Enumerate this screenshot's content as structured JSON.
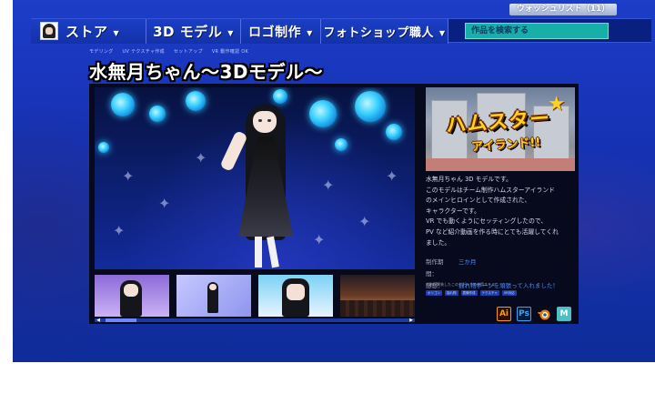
{
  "wishlist": {
    "label": "ウォッシュリスト（11）"
  },
  "nav": {
    "store_label": "ストア",
    "model_label": "3D モデル",
    "logo_label": "ロゴ制作",
    "photoshop_label": "フォトショップ職人",
    "caret": "▼",
    "search_placeholder": "作品を検索する"
  },
  "breadcrumb": [
    "モデリング",
    "UV テクスチャ作成",
    "セットアップ",
    "VR 動作確認 OK"
  ],
  "page": {
    "title": "水無月ちゃん〜3Dモデル〜"
  },
  "gallery": {
    "scroll_left": "◀",
    "scroll_right": "▶"
  },
  "banner": {
    "logo_main": "ハムスター",
    "logo_sub": "アイランド!!",
    "star": "★"
  },
  "description": "水無月ちゃん 3D モデルです。\nこのモデルはチーム制作ハムスターアイランド\nのメインヒロインとして作成された、\nキャラクターです。\nVR でも動くようにセッティングしたので、\nPV など紹介動画を作る時にとても活躍してくれ\nました。",
  "meta": {
    "period_key": "制作期間：",
    "period_val": "三か月",
    "impression_key": "感想：",
    "impression_val": "揺れ物ボーンを頑張って入れました！"
  },
  "tools": {
    "label": "作者が実装したこのモデルでの使用スキル",
    "tags": [
      "ポリゴン",
      "揺れ物",
      "表情作成",
      "テクスチャ",
      "VR対応"
    ]
  },
  "apps": {
    "ai": "Ai",
    "ps": "Ps",
    "blender_icon": "blender-icon",
    "m": "M"
  },
  "colors": {
    "background": "#1733b6",
    "nav": "#1a3ec6",
    "search": "#16b0a8",
    "logo_yellow": "#ffd21f",
    "meta_value": "#4a8cff"
  }
}
